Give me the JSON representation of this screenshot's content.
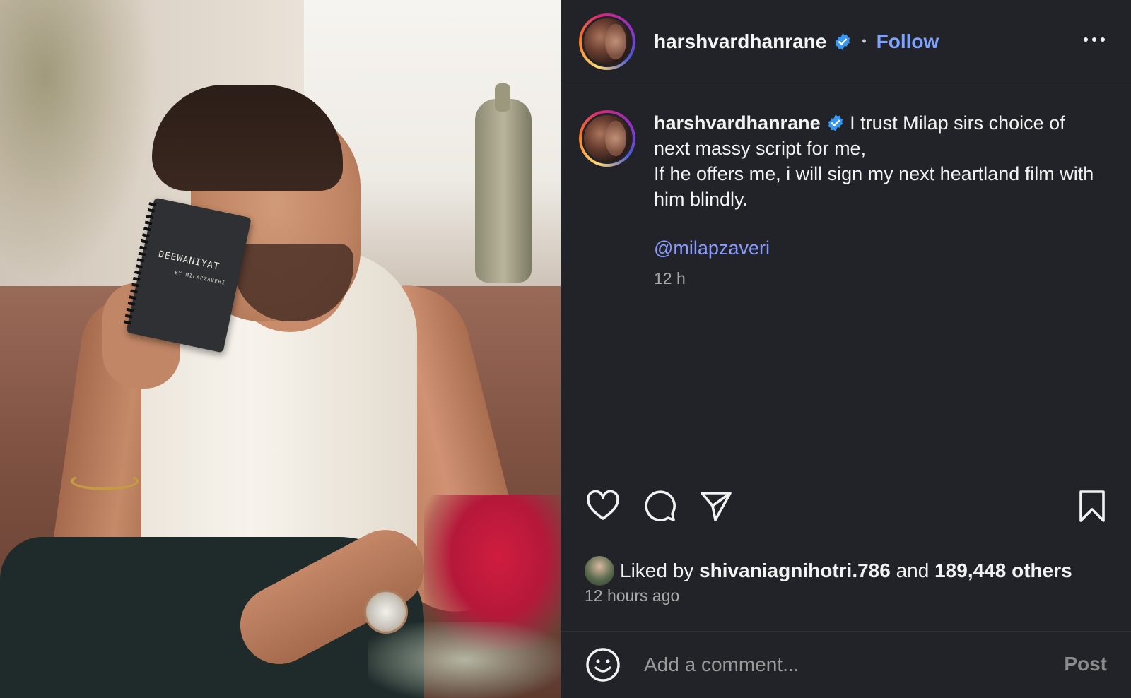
{
  "photo": {
    "notebook_title": "DEEWANIYAT",
    "notebook_subtitle": "BY MILAPZAVERI"
  },
  "header": {
    "username": "harshvardhanrane",
    "separator": "•",
    "follow_label": "Follow",
    "more_icon": "more-horizontal-icon"
  },
  "caption": {
    "username": "harshvardhanrane",
    "text": " I trust Milap sirs choice of next massy script for me,\nIf he offers me, i will sign my next heartland film with him blindly.",
    "mention": "@milapzaveri",
    "time": "12 h"
  },
  "actions": {
    "like_icon": "heart-icon",
    "comment_icon": "comment-icon",
    "share_icon": "send-icon",
    "save_icon": "bookmark-icon"
  },
  "likes": {
    "prefix": "Liked by",
    "liked_user": "shivaniagnihotri.786",
    "middle": "and",
    "others": "189,448 others"
  },
  "posted": "12 hours ago",
  "comment": {
    "placeholder": "Add a comment...",
    "post_label": "Post"
  },
  "colors": {
    "panel_bg": "#222329",
    "link_blue": "#7ea2ff",
    "verified_blue": "#3897f0"
  }
}
